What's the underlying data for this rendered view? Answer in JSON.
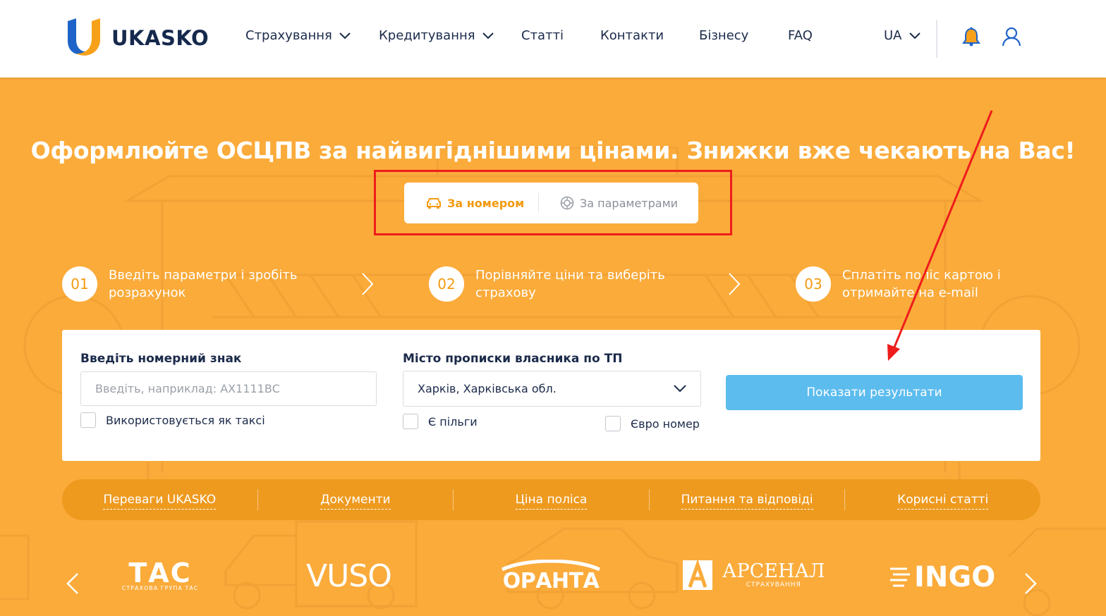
{
  "header": {
    "logo_text": "UKASKO",
    "nav": [
      {
        "label": "Страхування",
        "has_dropdown": true
      },
      {
        "label": "Кредитування",
        "has_dropdown": true
      },
      {
        "label": "Статті",
        "has_dropdown": false
      },
      {
        "label": "Контакти",
        "has_dropdown": false
      },
      {
        "label": "Бізнесу",
        "has_dropdown": false
      },
      {
        "label": "FAQ",
        "has_dropdown": false
      }
    ],
    "language": "UA",
    "icons": [
      "bell-icon",
      "user-icon"
    ]
  },
  "hero": {
    "title": "Оформлюйте ОСЦПВ за найвигіднішими цінами. Знижки вже чекають на Вас!",
    "tabs": [
      {
        "label": "За номером",
        "icon": "car-icon",
        "active": true
      },
      {
        "label": "За параметрами",
        "icon": "wheel-icon",
        "active": false
      }
    ]
  },
  "steps": [
    {
      "number": "01",
      "text": "Введіть параметри і зробіть розрахунок"
    },
    {
      "number": "02",
      "text": "Порівняйте ціни та виберіть страхову"
    },
    {
      "number": "03",
      "text": "Сплатіть поліс картою і отримайте на e-mail"
    }
  ],
  "form": {
    "plate_label": "Введіть номерний знак",
    "plate_placeholder": "Введіть, наприклад: АХ1111ВС",
    "taxi_label": "Використовується як таксі",
    "city_label": "Місто прописки власника по ТП",
    "city_value": "Харків, Харківська обл.",
    "benefits_label": "Є пільги",
    "euro_label": "Євро номер",
    "submit_label": "Показати результати"
  },
  "info_bar": [
    "Переваги UKASKO",
    "Документи",
    "Ціна поліса",
    "Питання та відповіді",
    "Корисні статті"
  ],
  "partners": [
    {
      "name": "ТАС",
      "subtitle": "СТРАХОВА ГРУПА ТАС"
    },
    {
      "name": "VUSO"
    },
    {
      "name": "ОРАНТА"
    },
    {
      "name": "АРСЕНАЛ",
      "subtitle": "СТРАХУВАННЯ"
    },
    {
      "name": "INGO"
    }
  ],
  "colors": {
    "hero_bg": "#fbab3a",
    "accent_orange": "#f39a10",
    "button_blue": "#5cbcee",
    "annotation_red": "#ee1c1c",
    "navy": "#16294d"
  }
}
